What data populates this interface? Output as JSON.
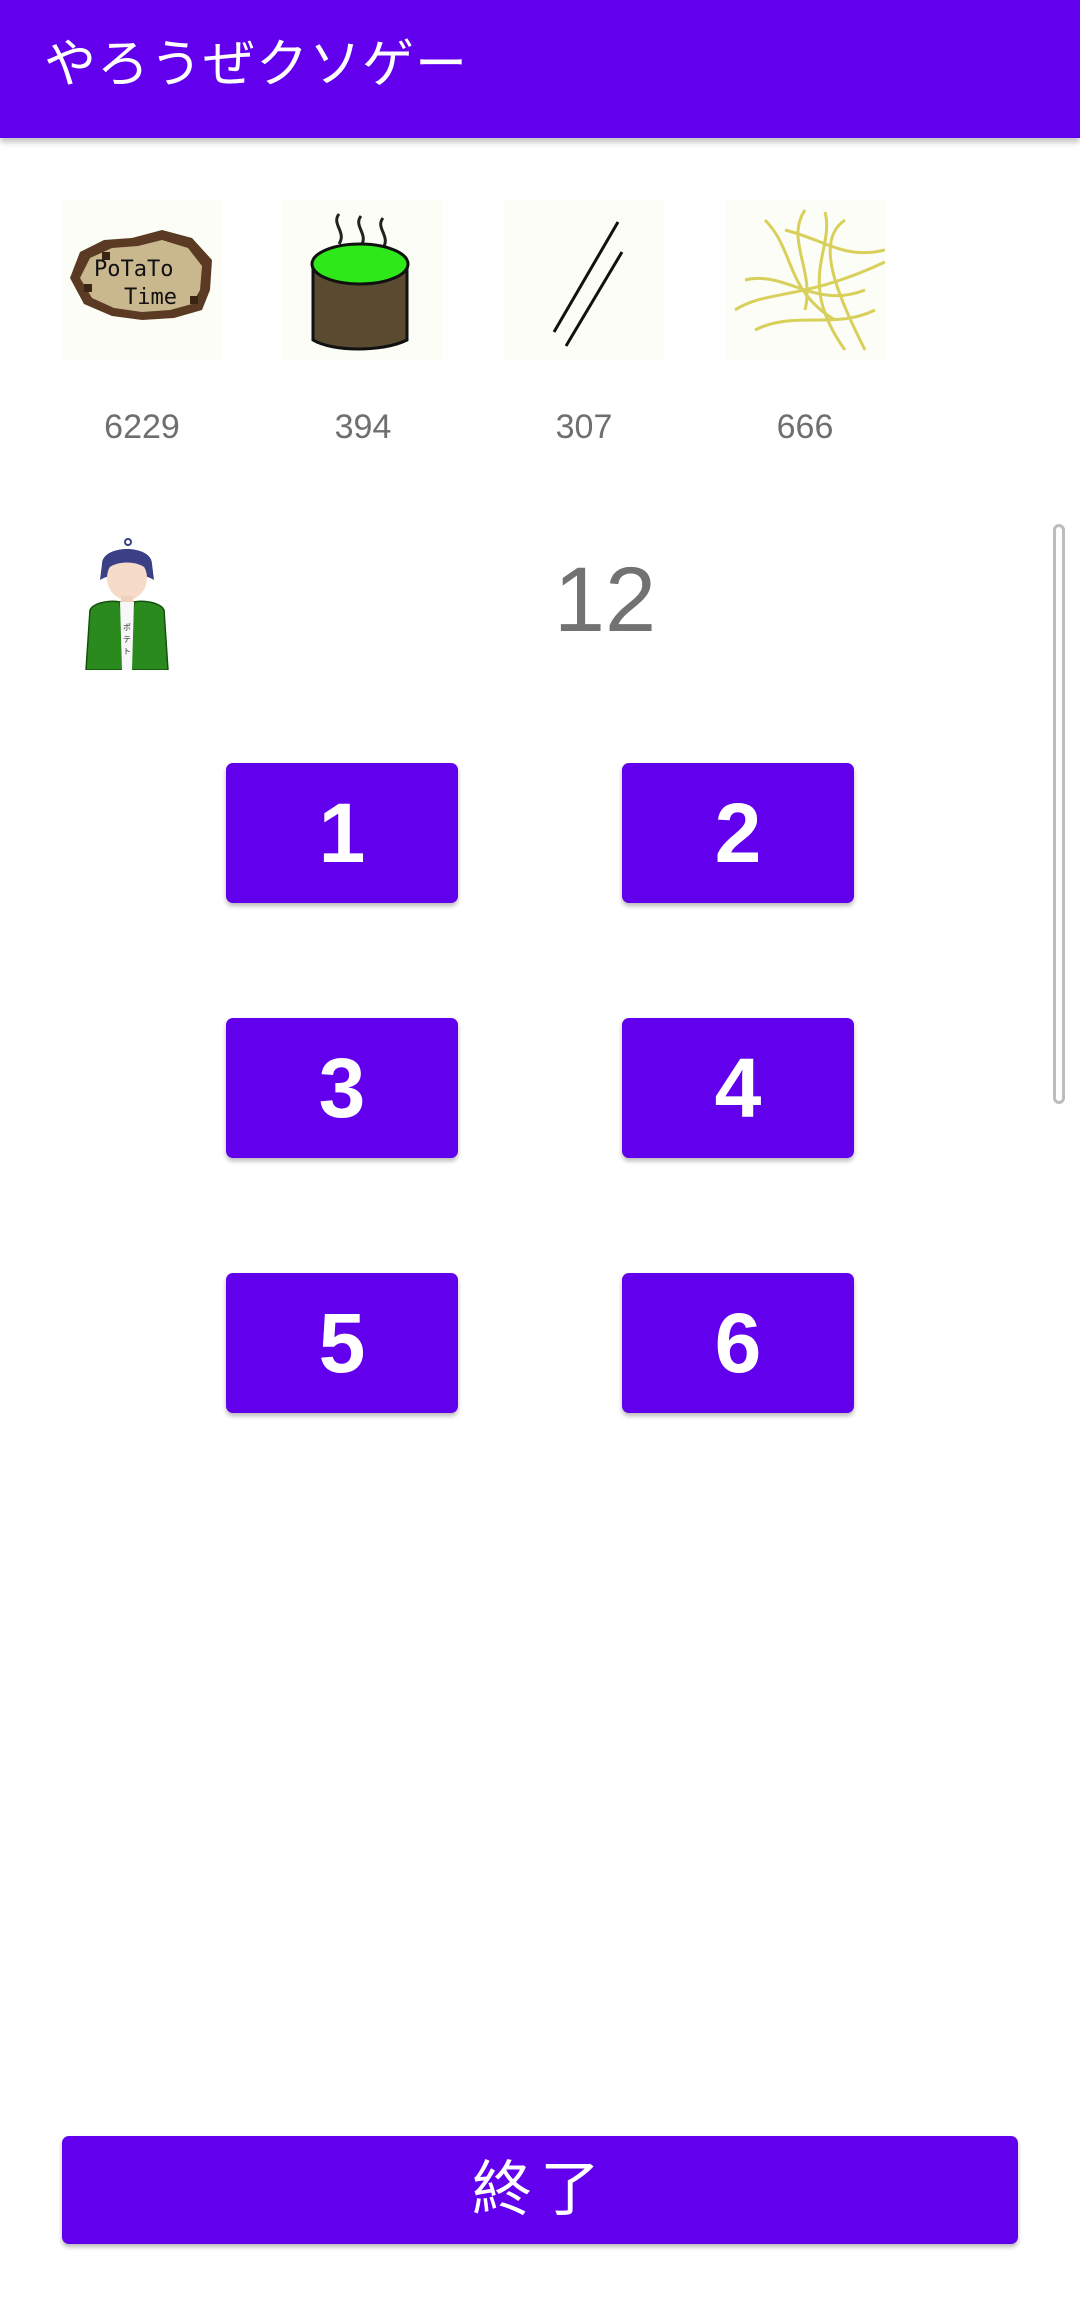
{
  "app": {
    "title": "やろうぜクソゲー",
    "brand_color": "#6200ee"
  },
  "items": [
    {
      "icon": "potato-time-sign-icon",
      "count": "6229"
    },
    {
      "icon": "steaming-green-cup-icon",
      "count": "394"
    },
    {
      "icon": "chopsticks-icon",
      "count": "307"
    },
    {
      "icon": "noodles-icon",
      "count": "666"
    }
  ],
  "character": {
    "icon": "boy-green-jacket-icon"
  },
  "score": "12",
  "buttons": {
    "b1": "1",
    "b2": "2",
    "b3": "3",
    "b4": "4",
    "b5": "5",
    "b6": "6",
    "end": "終了"
  }
}
